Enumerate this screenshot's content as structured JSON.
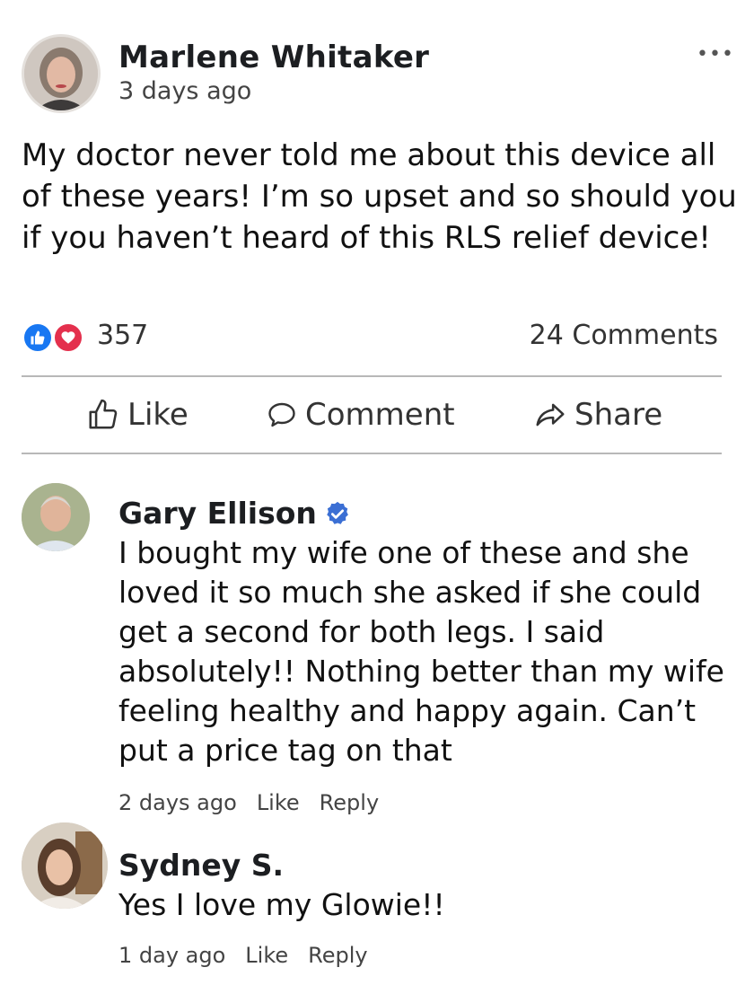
{
  "post": {
    "author": "Marlene Whitaker",
    "time": "3 days ago",
    "more_label": "•••",
    "body": "My doctor never told me about this device all of these years! I’m so upset and so should you if you haven’t heard of this RLS relief device!",
    "reaction_count": "357",
    "comment_count": "24 Comments"
  },
  "actions": {
    "like": "Like",
    "comment": "Comment",
    "share": "Share"
  },
  "comments": [
    {
      "author": "Gary Ellison",
      "verified": true,
      "text": "I bought my wife one of these and she loved it so much she asked if she could get a second for both legs. I said absolutely!! Nothing better than my wife feeling healthy and happy again. Can’t put a price tag on that",
      "time": "2 days ago",
      "like": "Like",
      "reply": "Reply"
    },
    {
      "author": "Sydney S.",
      "verified": false,
      "text": "Yes I love my Glowie!!",
      "time": "1 day ago",
      "like": "Like",
      "reply": "Reply"
    }
  ],
  "colors": {
    "like_blue": "#1877f2",
    "love_red": "#e4304d",
    "verified_blue": "#3b6fd4"
  }
}
